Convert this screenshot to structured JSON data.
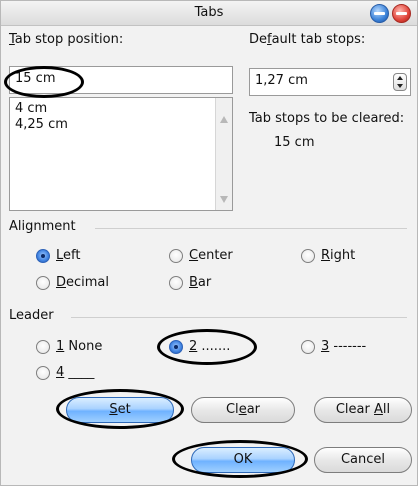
{
  "window": {
    "title": "Tabs"
  },
  "tab_stop": {
    "label_prefix": "",
    "label_accel": "T",
    "label_rest": "ab stop position:",
    "value": "15 cm",
    "list": [
      "4 cm",
      "4,25 cm"
    ]
  },
  "default_tabs": {
    "label_prefix": "De",
    "label_accel": "f",
    "label_rest": "ault tab stops:",
    "value": "1,27 cm"
  },
  "cleared": {
    "label": "Tab stops to be cleared:",
    "value": "15 cm"
  },
  "alignment": {
    "label": "Alignment",
    "left": {
      "accel": "L",
      "rest": "eft"
    },
    "center": {
      "accel": "C",
      "rest": "enter"
    },
    "right": {
      "accel": "R",
      "rest": "ight"
    },
    "decimal": {
      "accel": "D",
      "rest": "ecimal"
    },
    "bar": {
      "accel": "B",
      "rest": "ar"
    },
    "selected": "Left"
  },
  "leader": {
    "label": "Leader",
    "opt1": {
      "accel": "1",
      "rest": " None"
    },
    "opt2": {
      "accel": "2",
      "rest": " ......."
    },
    "opt3": {
      "accel": "3",
      "rest": " -------"
    },
    "opt4": {
      "accel": "4",
      "rest": " ____"
    },
    "selected": "2"
  },
  "buttons": {
    "set": {
      "accel": "S",
      "rest": "et"
    },
    "clear": {
      "prefix": "Cl",
      "accel": "e",
      "rest": "ar"
    },
    "clear_all": {
      "prefix": "Clear ",
      "accel": "A",
      "rest": "ll"
    },
    "ok": "OK",
    "cancel": "Cancel"
  }
}
